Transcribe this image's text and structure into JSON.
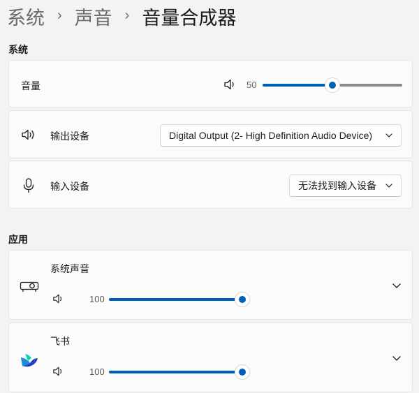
{
  "breadcrumb": {
    "level1": "系统",
    "level2": "声音",
    "current": "音量合成器"
  },
  "system_section": {
    "heading": "系统",
    "volume": {
      "label": "音量",
      "value": 50,
      "value_text": "50"
    },
    "output_device": {
      "label": "输出设备",
      "selected": "Digital Output (2- High Definition Audio Device)"
    },
    "input_device": {
      "label": "输入设备",
      "selected": "无法找到输入设备"
    }
  },
  "apps_section": {
    "heading": "应用",
    "apps": [
      {
        "name": "系统声音",
        "icon": "projector-icon",
        "volume": 100,
        "volume_text": "100"
      },
      {
        "name": "飞书",
        "icon": "feishu-logo-icon",
        "volume": 100,
        "volume_text": "100"
      }
    ]
  },
  "colors": {
    "accent": "#005fb8",
    "track": "#8a8a8a",
    "background": "#f3f3f3",
    "card": "#fbfbfb"
  }
}
